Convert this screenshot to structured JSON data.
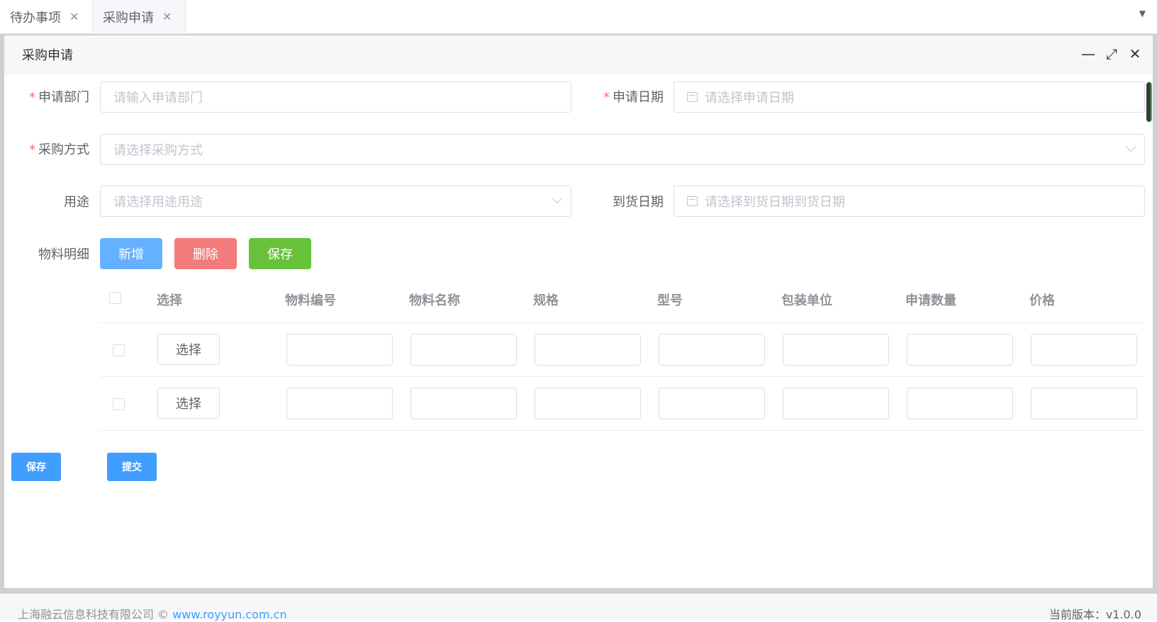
{
  "tabs": [
    {
      "label": "待办事项",
      "close": "✕"
    },
    {
      "label": "采购申请",
      "close": "✕"
    }
  ],
  "tab_dropdown_icon": "caret-down-icon",
  "window": {
    "title": "采购申请",
    "minimize": "—",
    "maximize": "⤢",
    "close": "✕"
  },
  "form": {
    "required_mark": "*",
    "dept_label": "申请部门",
    "dept_placeholder": "请输入申请部门",
    "date_label": "申请日期",
    "date_placeholder": "请选择申请日期",
    "method_label": "采购方式",
    "method_placeholder": "请选择采购方式",
    "use_label": "用途",
    "use_placeholder": "请选择用途用途",
    "arrival_label": "到货日期",
    "arrival_placeholder": "请选择到货日期到货日期",
    "material_label": "物料明细",
    "add_btn": "新增",
    "delete_btn": "删除",
    "save_btn": "保存"
  },
  "table": {
    "headers": [
      "选择",
      "物料编号",
      "物料名称",
      "规格",
      "型号",
      "包装单位",
      "申请数量",
      "价格"
    ],
    "rows": [
      {
        "select_btn": "选择"
      },
      {
        "select_btn": "选择"
      }
    ]
  },
  "actions": {
    "save": "保存",
    "submit": "提交"
  },
  "footer": {
    "company": "上海融云信息科技有限公司 © ",
    "link": "www.royyun.com.cn",
    "version": "当前版本：v1.0.0"
  }
}
